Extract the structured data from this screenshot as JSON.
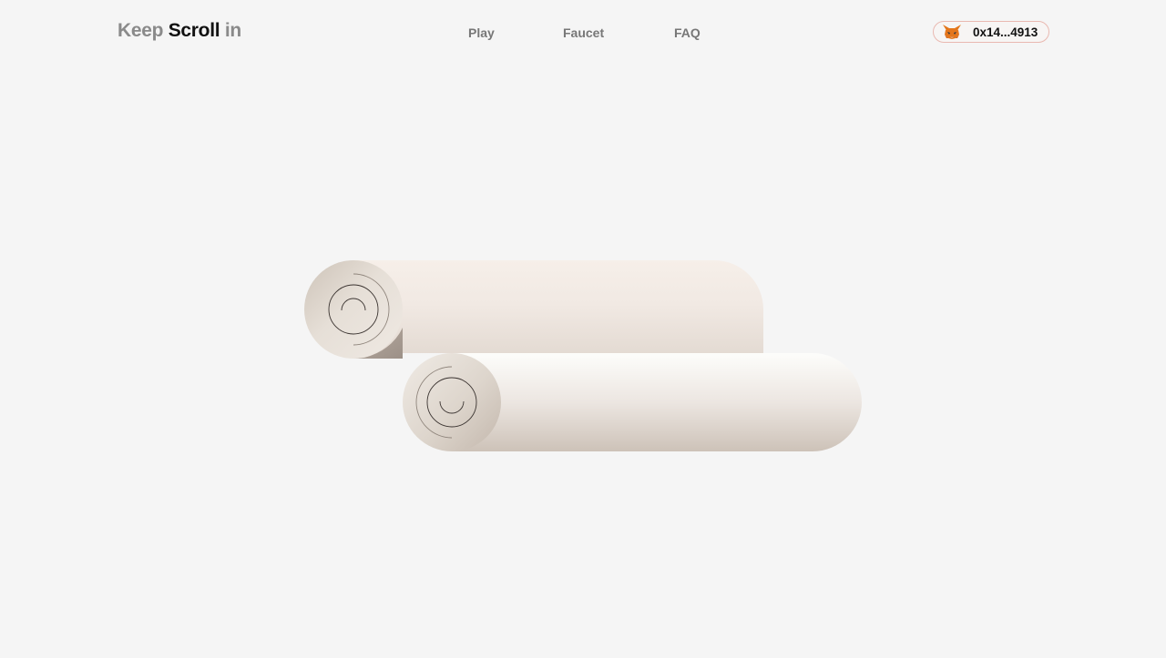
{
  "brand": {
    "part1": "Keep",
    "part2": "Scroll",
    "part3": "in"
  },
  "nav": {
    "items": [
      {
        "label": "Play"
      },
      {
        "label": "Faucet"
      },
      {
        "label": "FAQ"
      }
    ]
  },
  "wallet": {
    "address": "0x14...4913",
    "icon": "metamask-fox-icon"
  },
  "colors": {
    "background": "#f5f5f5",
    "wallet_border": "#e9b9b1",
    "parchment_light": "#f6efe9",
    "parchment_dark": "#cbbfb3"
  },
  "hero": {
    "icon": "scroll-illustration"
  }
}
